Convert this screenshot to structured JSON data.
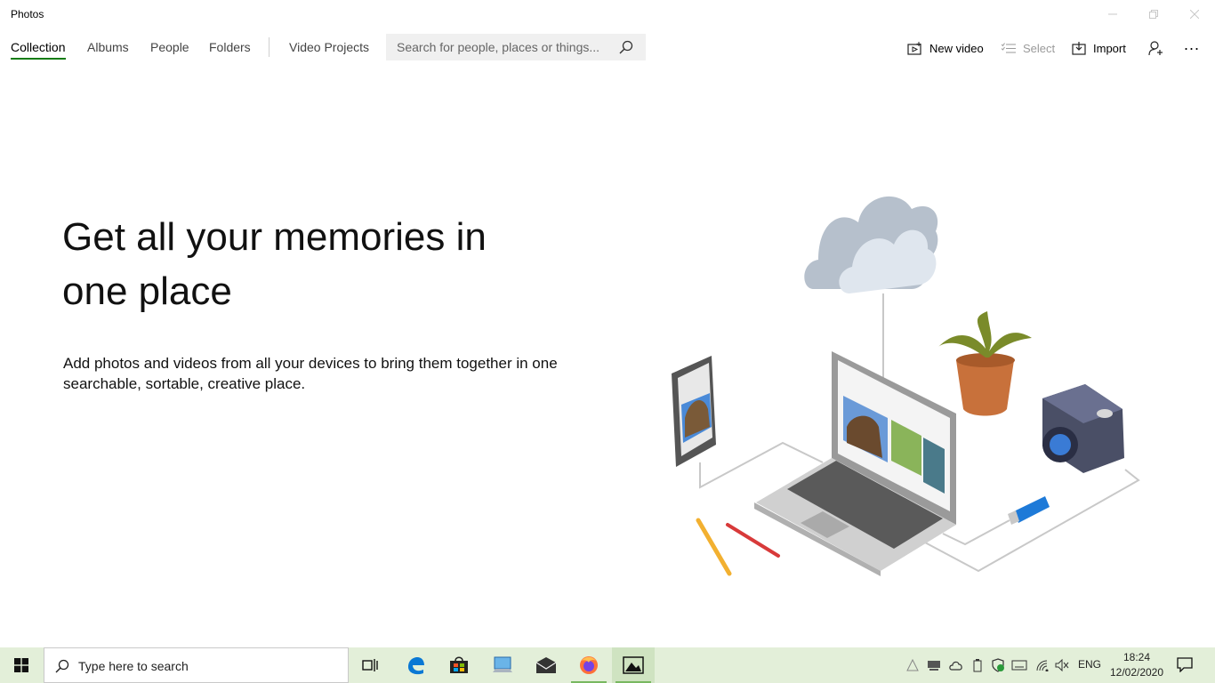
{
  "window": {
    "title": "Photos",
    "controls": [
      "minimize",
      "maximize",
      "close"
    ]
  },
  "nav": {
    "tabs": [
      {
        "label": "Collection",
        "active": true
      },
      {
        "label": "Albums",
        "active": false
      },
      {
        "label": "People",
        "active": false
      },
      {
        "label": "Folders",
        "active": false
      },
      {
        "label": "Video Projects",
        "active": false
      }
    ],
    "search_placeholder": "Search for people, places or things...",
    "commands": {
      "new_video": "New video",
      "select": "Select",
      "import": "Import",
      "more": "..."
    }
  },
  "hero": {
    "heading": "Get all your memories in one place",
    "body": "Add photos and videos from all your devices to bring them together in one searchable, sortable, creative place."
  },
  "taskbar": {
    "search_placeholder": "Type here to search",
    "apps": [
      "task-view-icon",
      "edge-icon",
      "store-icon",
      "remote-desktop-icon",
      "mail-icon",
      "firefox-icon",
      "photos-icon"
    ],
    "language": "ENG",
    "time": "18:24",
    "date": "12/02/2020"
  },
  "colors": {
    "accent": "#107c10",
    "taskbar": "#e3efd9",
    "search_bg": "#f0f0f0"
  }
}
